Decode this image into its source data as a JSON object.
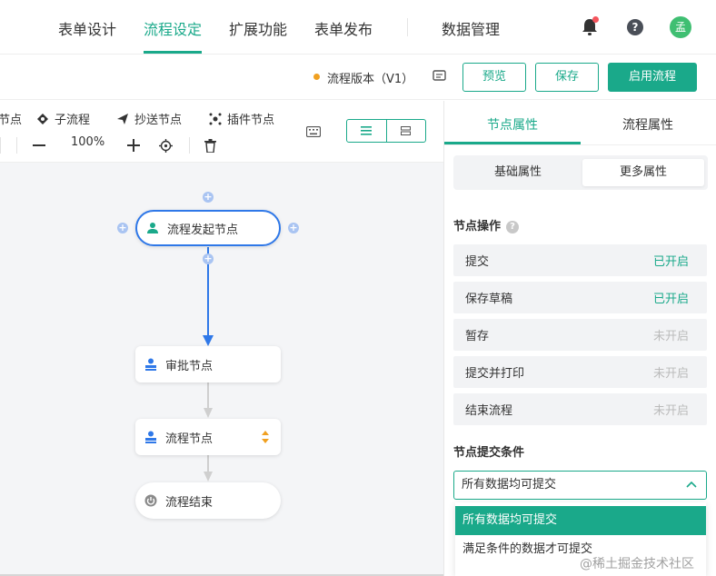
{
  "nav": {
    "tabs": [
      {
        "label": "表单设计",
        "active": false
      },
      {
        "label": "流程设定",
        "active": true
      },
      {
        "label": "扩展功能",
        "active": false
      },
      {
        "label": "表单发布",
        "active": false
      },
      {
        "label": "数据管理",
        "active": false
      }
    ],
    "avatar_text": "孟",
    "help_icon": "question-icon",
    "accent_color": "#1aa98a"
  },
  "actions": {
    "version": "流程版本（V1）",
    "preview": "预览",
    "save": "保存",
    "enable": "启用流程"
  },
  "canvas_toolbar": {
    "items": [
      "节点",
      "子流程",
      "抄送节点",
      "插件节点"
    ],
    "zoom": "100%"
  },
  "flow": {
    "start": "流程发起节点",
    "approve": "审批节点",
    "process": "流程节点",
    "end": "流程结束"
  },
  "panel": {
    "tabs": [
      "节点属性",
      "流程属性"
    ],
    "subtabs": [
      "基础属性",
      "更多属性"
    ],
    "ops_title": "节点操作",
    "ops": [
      {
        "label": "提交",
        "status": "已开启",
        "on": true
      },
      {
        "label": "保存草稿",
        "status": "已开启",
        "on": true
      },
      {
        "label": "暂存",
        "status": "未开启",
        "on": false
      },
      {
        "label": "提交并打印",
        "status": "未开启",
        "on": false
      },
      {
        "label": "结束流程",
        "status": "未开启",
        "on": false
      }
    ],
    "submit_title": "节点提交条件",
    "select_value": "所有数据均可提交",
    "options": [
      "所有数据均可提交",
      "满足条件的数据才可提交"
    ]
  },
  "watermark": "@稀土掘金技术社区"
}
